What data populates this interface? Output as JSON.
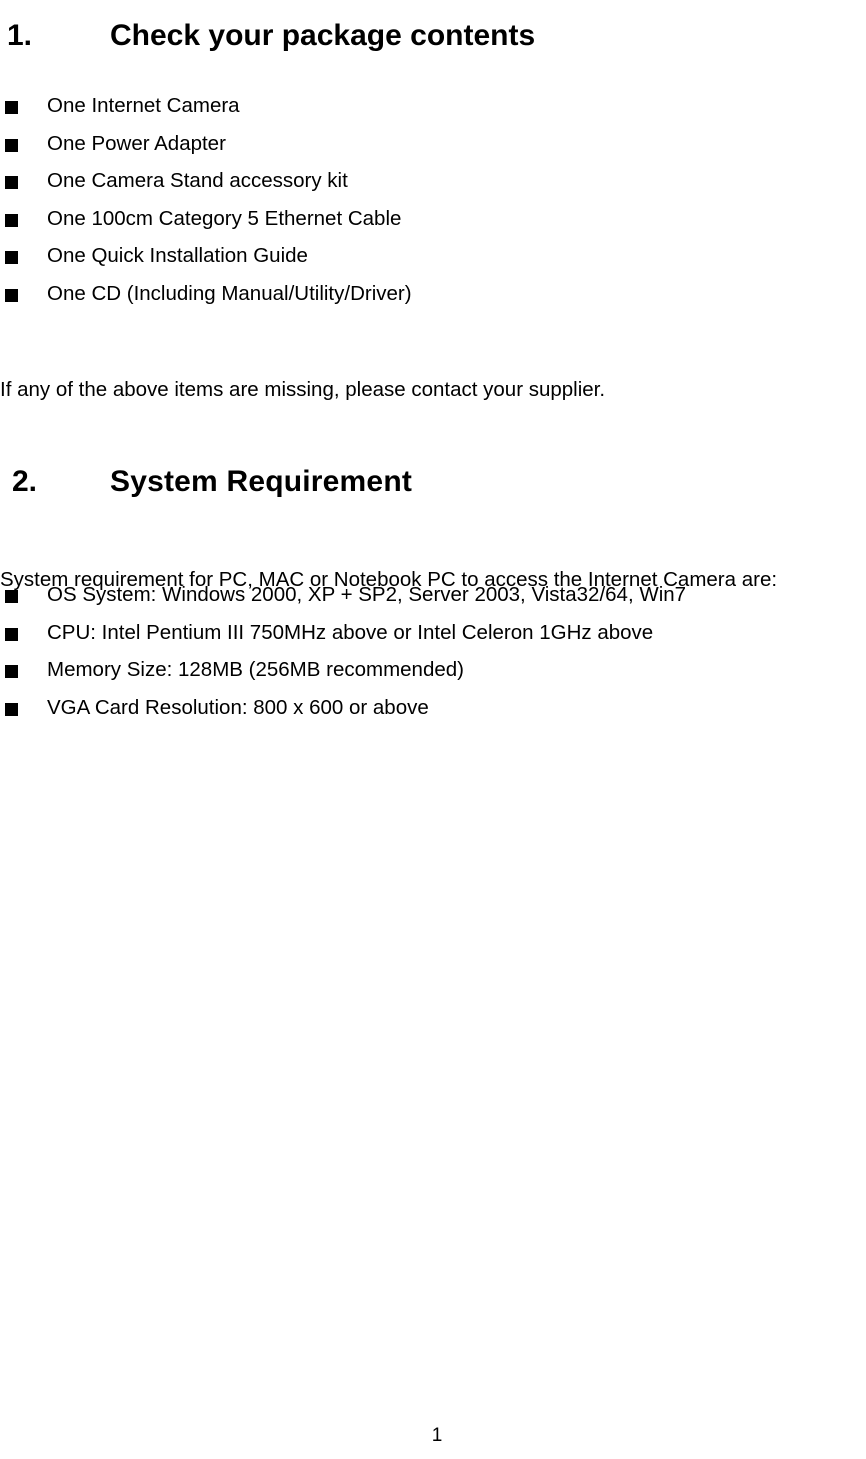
{
  "document": {
    "page_number": "1",
    "sections": [
      {
        "number": "1.",
        "title": "Check your package contents"
      },
      {
        "number": "2.",
        "title": "System Requirement"
      }
    ]
  },
  "package_contents": {
    "items": [
      "One Internet Camera",
      "One Power Adapter",
      "One Camera Stand accessory kit",
      "One 100cm Category 5 Ethernet Cable",
      "One Quick Installation Guide",
      "One CD (Including Manual/Utility/Driver)"
    ],
    "note": "If any of the above items are missing, please contact your supplier."
  },
  "system_requirement": {
    "intro": "System requirement for PC, MAC or Notebook PC to access the Internet Camera are:",
    "items": [
      "OS System: Windows 2000, XP + SP2, Server 2003, Vista32/64, Win7",
      "CPU: Intel Pentium III 750MHz above or Intel Celeron 1GHz above",
      "Memory Size: 128MB (256MB recommended)",
      "VGA Card Resolution: 800 x 600 or above"
    ]
  },
  "icons": {
    "bullet": "filled-square-bullet"
  }
}
